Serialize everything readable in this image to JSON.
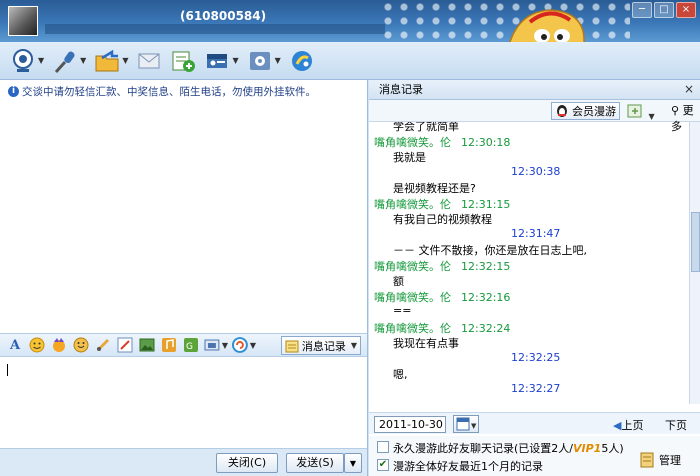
{
  "window": {
    "title": "(610800584)",
    "buttons": [
      "─",
      "□",
      "×"
    ]
  },
  "toolbar": {
    "icons": [
      "webcam-icon",
      "microphone-icon",
      "folder-transfer-icon",
      "mail-icon",
      "add-app-icon",
      "profile-card-icon",
      "settings-icon",
      "qq-app-icon"
    ]
  },
  "notice": "交谈中请勿轻信汇款、中奖信息、陌生电话，勿使用外挂软件。",
  "format_bar": {
    "history_button": "消息记录"
  },
  "input": {
    "value": ""
  },
  "actions": {
    "close": "关闭(C)",
    "send": "发送(S)"
  },
  "history": {
    "title": "消息记录",
    "close": "×",
    "vip_roam": "会员漫游",
    "more": "更多",
    "messages": [
      {
        "kind": "text",
        "text": "学会了就简单"
      },
      {
        "kind": "sender",
        "name": "嘴角噙微笑。伦",
        "time": "12:30:18"
      },
      {
        "kind": "text",
        "text": "我就是"
      },
      {
        "kind": "mytime",
        "time": "12:30:38"
      },
      {
        "kind": "text",
        "text": "是视频教程还是?"
      },
      {
        "kind": "sender",
        "name": "嘴角噙微笑。伦",
        "time": "12:31:15"
      },
      {
        "kind": "text",
        "text": "有我自己的视频教程"
      },
      {
        "kind": "mytime",
        "time": "12:31:47"
      },
      {
        "kind": "text",
        "text": "－－ 文件不散接，你还是放在日志上吧,"
      },
      {
        "kind": "sender",
        "name": "嘴角噙微笑。伦",
        "time": "12:32:15"
      },
      {
        "kind": "text",
        "text": "额"
      },
      {
        "kind": "sender",
        "name": "嘴角噙微笑。伦",
        "time": "12:32:16"
      },
      {
        "kind": "text",
        "text": "=="
      },
      {
        "kind": "sender",
        "name": "嘴角噙微笑。伦",
        "time": "12:32:24"
      },
      {
        "kind": "text",
        "text": "我现在有点事"
      },
      {
        "kind": "mytime",
        "time": "12:32:25"
      },
      {
        "kind": "text",
        "text": "嗯,"
      },
      {
        "kind": "mytime",
        "time": "12:32:27"
      }
    ],
    "date": "2011-10-30",
    "prev_page": "上页",
    "next_page": "下页",
    "option1": "永久漫游此好友聊天记录(已设置2人/",
    "option1_vip": "VIP1",
    "option1_tail": "5人)",
    "option2": "漫游全体好友最近1个月的记录",
    "manage": "管理"
  }
}
